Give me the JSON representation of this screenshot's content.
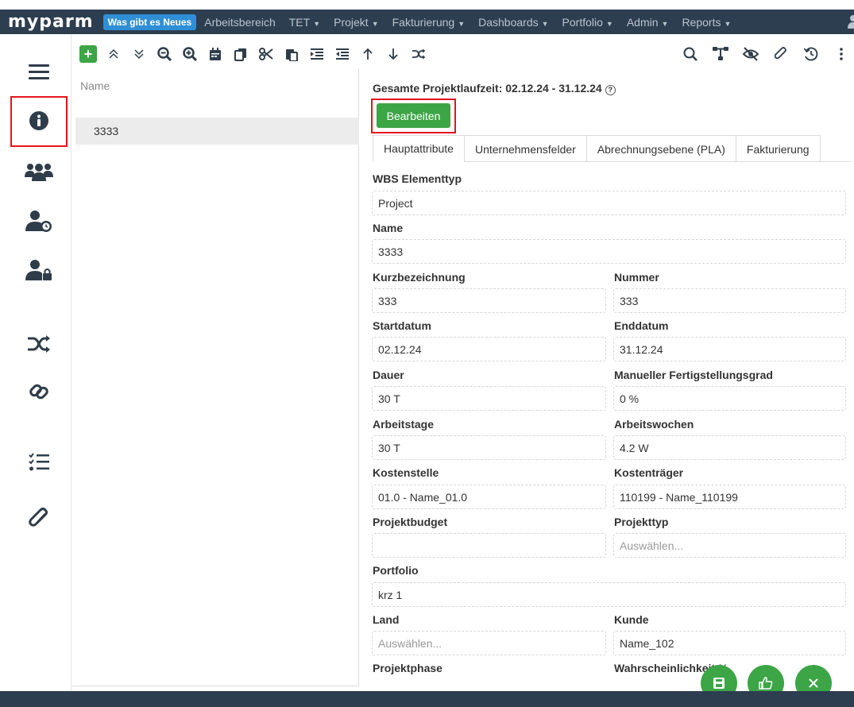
{
  "nav": {
    "logo": "myparm",
    "news_badge": "Was gibt es Neues",
    "items": [
      {
        "label": "Arbeitsbereich",
        "caret": false
      },
      {
        "label": "TET",
        "caret": true
      },
      {
        "label": "Projekt",
        "caret": true
      },
      {
        "label": "Fakturierung",
        "caret": true
      },
      {
        "label": "Dashboards",
        "caret": true
      },
      {
        "label": "Portfolio",
        "caret": true
      },
      {
        "label": "Admin",
        "caret": true
      },
      {
        "label": "Reports",
        "caret": true
      }
    ]
  },
  "sidebar": {
    "icons": [
      "menu-icon",
      "info-icon",
      "users-icon",
      "user-clock-icon",
      "user-lock-icon",
      "shuffle-icon",
      "link-icon",
      "checklist-icon",
      "paperclip-icon"
    ]
  },
  "toolbar": {
    "left_icons": [
      "add-icon",
      "collapse-all-icon",
      "expand-all-icon",
      "zoom-out-icon",
      "zoom-in-icon",
      "calendar-icon",
      "copy-icon",
      "cut-icon",
      "paste-icon",
      "indent-icon",
      "outdent-icon",
      "move-up-icon",
      "move-down-icon",
      "shuffle-icon"
    ],
    "right_icons": [
      "search-icon",
      "hierarchy-icon",
      "hide-icon",
      "paperclip-icon",
      "history-icon",
      "more-icon"
    ]
  },
  "tree": {
    "header": "Name",
    "rows": [
      "3333"
    ]
  },
  "detail": {
    "laufzeit": "Gesamte Projektlaufzeit: 02.12.24 - 31.12.24",
    "edit_label": "Bearbeiten",
    "tabs": [
      "Hauptattribute",
      "Unternehmensfelder",
      "Abrechnungsebene (PLA)",
      "Fakturierung"
    ],
    "fields": {
      "wbs_label": "WBS Elementtyp",
      "wbs_value": "Project",
      "name_label": "Name",
      "name_value": "3333",
      "kurz_label": "Kurzbezeichnung",
      "kurz_value": "333",
      "nummer_label": "Nummer",
      "nummer_value": "333",
      "start_label": "Startdatum",
      "start_value": "02.12.24",
      "end_label": "Enddatum",
      "end_value": "31.12.24",
      "dauer_label": "Dauer",
      "dauer_value": "30 T",
      "fertig_label": "Manueller Fertigstellungsgrad",
      "fertig_value": "0 %",
      "arbeitstage_label": "Arbeitstage",
      "arbeitstage_value": "30 T",
      "arbeitswochen_label": "Arbeitswochen",
      "arbeitswochen_value": "4.2 W",
      "kostenstelle_label": "Kostenstelle",
      "kostenstelle_value": "01.0 - Name_01.0",
      "kostentraeger_label": "Kostenträger",
      "kostentraeger_value": "110199 - Name_110199",
      "budget_label": "Projektbudget",
      "budget_value": "",
      "projekttyp_label": "Projekttyp",
      "projekttyp_placeholder": "Auswählen...",
      "portfolio_label": "Portfolio",
      "portfolio_value": "krz 1",
      "land_label": "Land",
      "land_placeholder": "Auswählen...",
      "kunde_label": "Kunde",
      "kunde_value": "Name_102",
      "phase_label": "Projektphase",
      "wahrsch_label": "Wahrscheinlichkeit %"
    }
  },
  "colors": {
    "navbar": "#2d3e50",
    "accent_green": "#3ca545",
    "badge_blue": "#2f8fd6",
    "highlight_red": "#e4141b"
  }
}
